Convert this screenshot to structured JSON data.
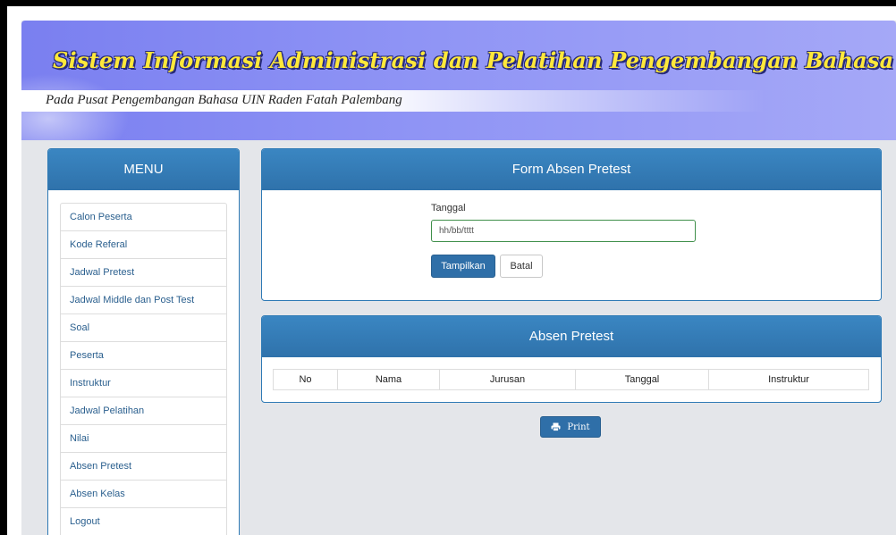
{
  "header": {
    "title": "Sistem Informasi Administrasi dan Pelatihan Pengembangan Bahasa",
    "subtitle": "Pada Pusat Pengembangan Bahasa UIN Raden  Fatah Palembang"
  },
  "sidebar": {
    "heading": "MENU",
    "items": [
      {
        "label": "Calon Peserta"
      },
      {
        "label": "Kode Referal"
      },
      {
        "label": "Jadwal Pretest"
      },
      {
        "label": "Jadwal Middle dan Post Test"
      },
      {
        "label": "Soal"
      },
      {
        "label": "Peserta"
      },
      {
        "label": "Instruktur"
      },
      {
        "label": "Jadwal Pelatihan"
      },
      {
        "label": "Nilai"
      },
      {
        "label": "Absen Pretest"
      },
      {
        "label": "Absen Kelas"
      },
      {
        "label": "Logout"
      }
    ]
  },
  "form": {
    "title": "Form Absen Pretest",
    "date_label": "Tanggal",
    "date_placeholder": "hh/bb/tttt",
    "submit_label": "Tampilkan",
    "cancel_label": "Batal"
  },
  "attendance_table": {
    "title": "Absen Pretest",
    "columns": [
      "No",
      "Nama",
      "Jurusan",
      "Tanggal",
      "Instruktur"
    ]
  },
  "print_button": {
    "label": "Print",
    "icon": "printer-icon"
  },
  "colors": {
    "panel_header": "#2f72ab",
    "banner": "#8f94f5",
    "title_text": "#ffe83a",
    "primary_button": "#2f6fa8"
  }
}
